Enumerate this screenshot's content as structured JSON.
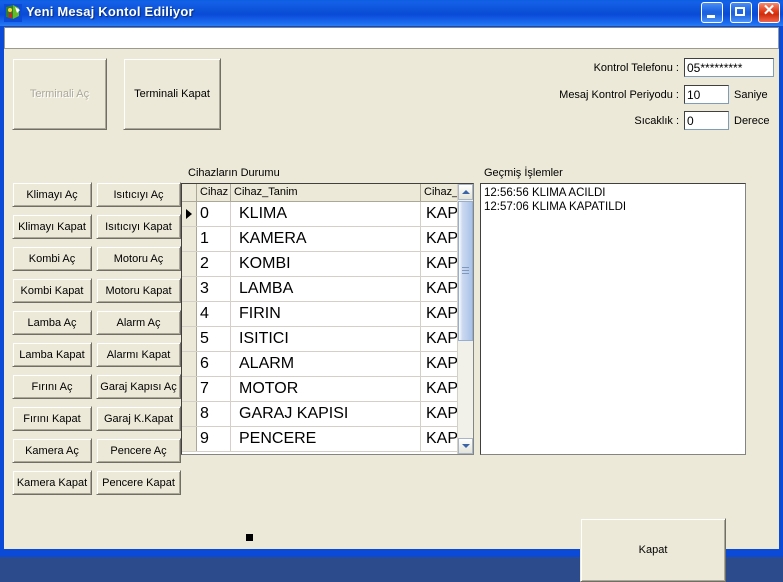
{
  "window": {
    "title": "Yeni Mesaj Kontol Ediliyor",
    "icon": "app-icon",
    "minimize_label": "_",
    "maximize_label": "□",
    "close_label": "✕"
  },
  "terminal": {
    "open_label": "Terminali Aç",
    "open_disabled": true,
    "close_label": "Terminali Kapat"
  },
  "settings": {
    "phone_label": "Kontrol Telefonu :",
    "phone_value": "05*********",
    "period_label": "Mesaj Kontrol Periyodu :",
    "period_value": "10",
    "period_unit": "Saniye",
    "temp_label": "Sıcaklık :",
    "temp_value": "0",
    "temp_unit": "Derece"
  },
  "commands": {
    "column_a": [
      "Klimayı Aç",
      "Klimayı Kapat",
      "Kombi Aç",
      "Kombi Kapat",
      "Lamba Aç",
      "Lamba Kapat",
      "Fırını Aç",
      "Fırını Kapat",
      "Kamera Aç",
      "Kamera Kapat"
    ],
    "column_b": [
      "Isıtıcıyı Aç",
      "Isıtıcıyı Kapat",
      "Motoru Aç",
      "Motoru Kapat",
      "Alarm Aç",
      "Alarmı Kapat",
      "Garaj Kapısı Aç",
      "Garaj K.Kapat",
      "Pencere Aç",
      "Pencere Kapat"
    ]
  },
  "device_grid": {
    "group_label": "Cihazların Durumu",
    "columns": [
      "Cihaz",
      "Cihaz_Tanim",
      "Cihaz_Durumu"
    ],
    "current_row_index": 0,
    "rows": [
      {
        "id": "0",
        "name": "KLIMA",
        "status": "KAPALI"
      },
      {
        "id": "1",
        "name": "KAMERA",
        "status": "KAPALI"
      },
      {
        "id": "2",
        "name": "KOMBI",
        "status": "KAPALI"
      },
      {
        "id": "3",
        "name": "LAMBA",
        "status": "KAPALI"
      },
      {
        "id": "4",
        "name": "FIRIN",
        "status": "KAPALI"
      },
      {
        "id": "5",
        "name": "ISITICI",
        "status": "KAPALI"
      },
      {
        "id": "6",
        "name": "ALARM",
        "status": "KAPALI"
      },
      {
        "id": "7",
        "name": "MOTOR",
        "status": "KAPALI"
      },
      {
        "id": "8",
        "name": "GARAJ KAPISI",
        "status": "KAPALI"
      },
      {
        "id": "9",
        "name": "PENCERE",
        "status": "KAPALI"
      }
    ]
  },
  "history": {
    "group_label": "Geçmiş İşlemler",
    "entries": [
      "12:56:56 KLIMA ACILDI",
      "12:57:06 KLIMA KAPATILDI"
    ]
  },
  "footer": {
    "close_label": "Kapat"
  },
  "colors": {
    "titlebar_blue": "#0a4ad6",
    "client_face": "#ece9d8",
    "field_white": "#ffffff",
    "button_shadow": "#aca899",
    "disabled_text": "#aca899"
  }
}
